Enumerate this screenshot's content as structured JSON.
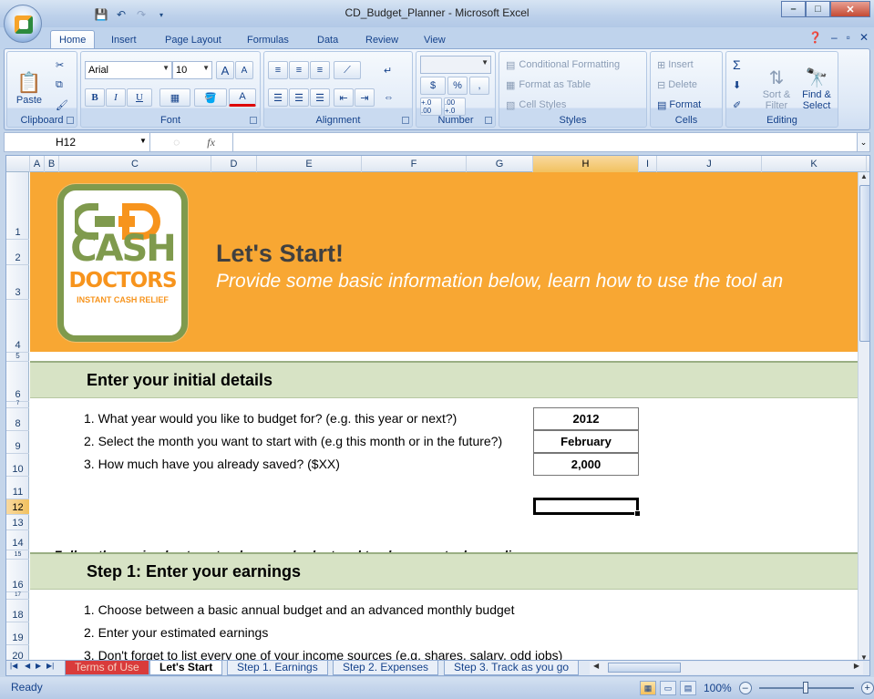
{
  "window": {
    "title": "CD_Budget_Planner - Microsoft Excel",
    "min": "–",
    "max": "□",
    "close": "✕"
  },
  "ribbon_tabs": [
    "Home",
    "Insert",
    "Page Layout",
    "Formulas",
    "Data",
    "Review",
    "View"
  ],
  "clipboard": {
    "label": "Clipboard",
    "paste": "Paste"
  },
  "font": {
    "label": "Font",
    "name": "Arial",
    "size": "10",
    "grow": "A",
    "shrink": "A",
    "bold": "B",
    "italic": "I",
    "underline": "U",
    "color": "A"
  },
  "alignment": {
    "label": "Alignment"
  },
  "number": {
    "label": "Number",
    "currency": "$",
    "percent": "%",
    "comma": ",",
    "incdec": "+.0 .00",
    "decdec": ".00 +.0"
  },
  "styles": {
    "label": "Styles",
    "conditional": "Conditional Formatting",
    "table": "Format as Table",
    "cell": "Cell Styles"
  },
  "cells": {
    "label": "Cells",
    "insert": "Insert",
    "delete": "Delete",
    "format": "Format"
  },
  "editing": {
    "label": "Editing",
    "sort": "Sort &",
    "filter": "Filter",
    "find": "Find &",
    "select": "Select",
    "sigma": "Σ"
  },
  "formula_bar": {
    "name_box": "H12",
    "fx": "fx",
    "value": ""
  },
  "columns": [
    "A",
    "B",
    "C",
    "D",
    "E",
    "F",
    "G",
    "H",
    "I",
    "J",
    "K"
  ],
  "rows": [
    "1",
    "2",
    "3",
    "4",
    "5",
    "6",
    "7",
    "8",
    "9",
    "10",
    "11",
    "12",
    "13",
    "14",
    "15",
    "16",
    "17",
    "18",
    "19",
    "20"
  ],
  "banner": {
    "logo_line1": "CASH",
    "logo_line2": "DOCTORS",
    "logo_line3": "INSTANT CASH RELIEF",
    "heading": "Let's Start!",
    "subheading": "Provide some basic information below, learn how to use the tool an"
  },
  "section1": {
    "title": "Enter your initial details"
  },
  "questions": [
    {
      "text": "1. What year would you like to budget for? (e.g. this year or next?)",
      "answer": "2012"
    },
    {
      "text": "2. Select the month you want to start with (e.g this month or in the future?)",
      "answer": "February"
    },
    {
      "text": "3. How much have you already saved? ($XX)",
      "answer": "2,000"
    }
  ],
  "follow": "Follow these simple steps to plan your budget and track your actual spending",
  "section2": {
    "title": "Step 1: Enter your earnings"
  },
  "steps": [
    "1. Choose between a basic annual budget and an advanced monthly budget",
    "2. Enter your estimated earnings",
    "3. Don't forget to list every one of your income sources (e.g. shares, salary, odd jobs)"
  ],
  "sheet_tabs": [
    "Terms of Use",
    "Let's Start",
    "Step 1. Earnings",
    "Step 2. Expenses",
    "Step 3. Track as you go"
  ],
  "status": {
    "ready": "Ready",
    "zoom": "100%"
  },
  "colors": {
    "banner": "#f8a733",
    "section": "#d7e3c5",
    "logo_green": "#7f9a4d",
    "logo_orange": "#f7941d"
  }
}
